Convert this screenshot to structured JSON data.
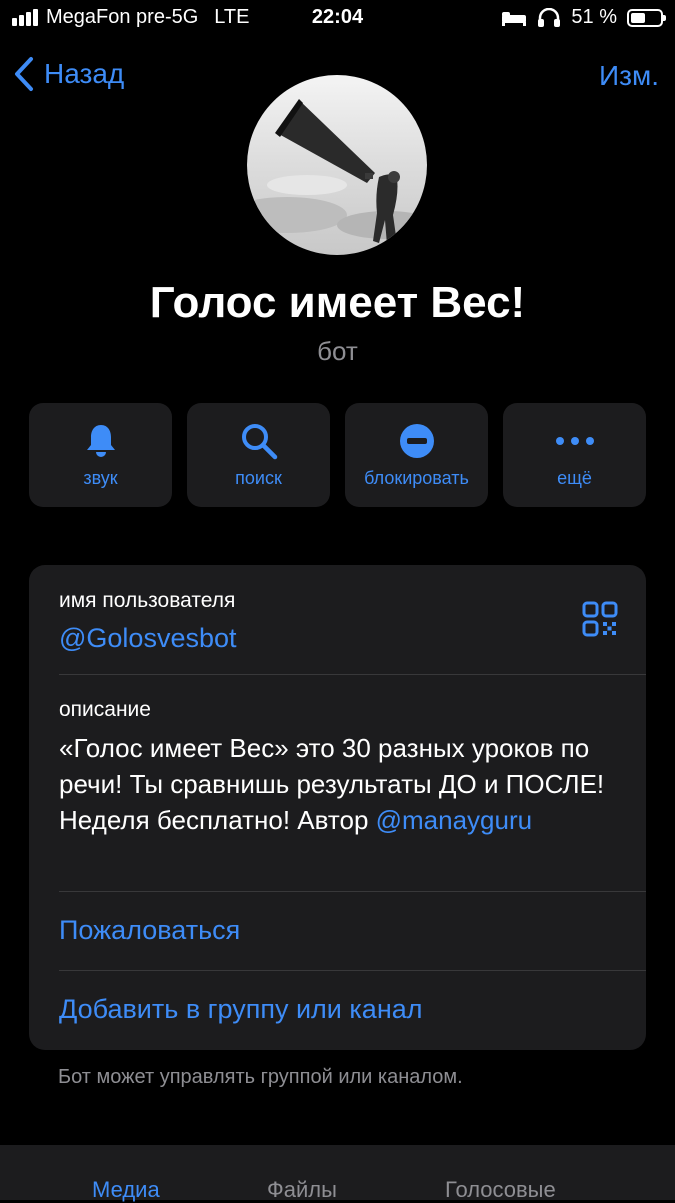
{
  "status_bar": {
    "carrier": "MegaFon pre-5G",
    "network": "LTE",
    "time": "22:04",
    "battery": "51 %",
    "battery_level": 0.51
  },
  "nav": {
    "back_label": "Назад",
    "edit_label": "Изм."
  },
  "profile": {
    "name": "Голос имеет Вес!",
    "type": "бот"
  },
  "actions": [
    {
      "label": "звук",
      "icon": "bell-icon"
    },
    {
      "label": "поиск",
      "icon": "search-icon"
    },
    {
      "label": "блокировать",
      "icon": "block-icon"
    },
    {
      "label": "ещё",
      "icon": "more-icon"
    }
  ],
  "info": {
    "username_label": "имя пользователя",
    "username": "@Golosvesbot",
    "description_label": "описание",
    "description_text": "«Голос имеет Вес» это 30 разных уроков по речи! Ты сравнишь результаты ДО и ПОСЛЕ! Неделя бесплатно! Автор ",
    "description_link": "@manayguru",
    "report_label": "Пожаловаться",
    "add_to_group_label": "Добавить в группу или канал"
  },
  "note": "Бот может управлять группой или каналом.",
  "tabs": [
    "Медиа",
    "Файлы",
    "Голосовые"
  ],
  "colors": {
    "accent": "#3e8cf7",
    "background": "#000000",
    "card": "#1c1c1e",
    "secondary_text": "#8e8e93"
  }
}
